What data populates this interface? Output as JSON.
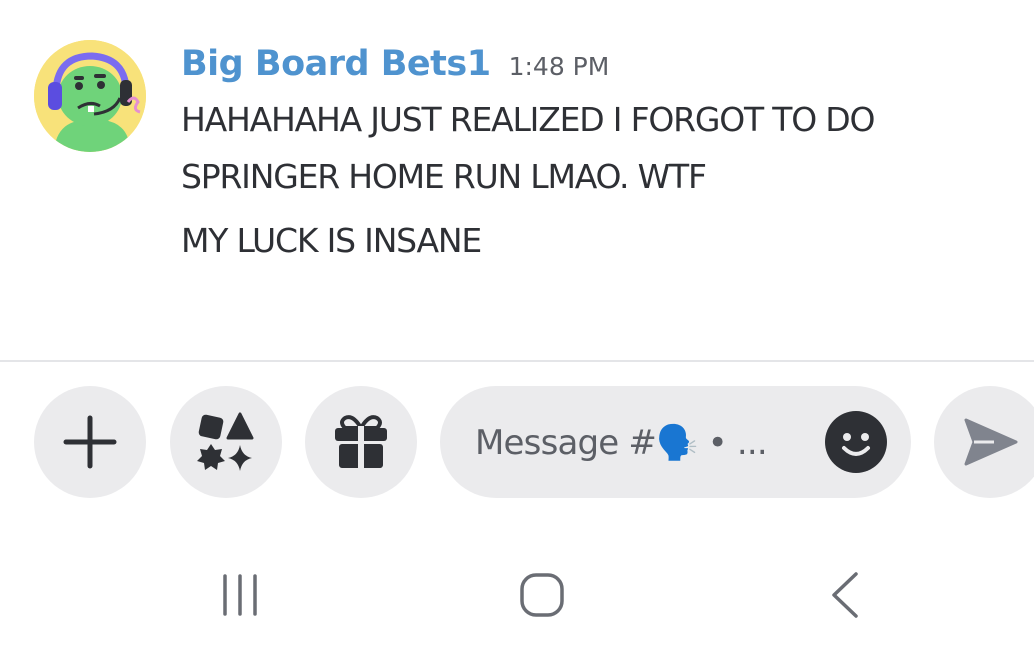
{
  "message": {
    "username": "Big Board Bets1",
    "timestamp": "1:48 PM",
    "lines": [
      "HAHAHAHA JUST REALIZED I FORGOT TO DO",
      "SPRINGER HOME RUN LMAO. WTF",
      "MY LUCK IS INSANE"
    ],
    "avatar_icon": "cartoon-avatar-with-headset"
  },
  "composer": {
    "placeholder": "Message #🗣️ • ...",
    "buttons": {
      "add": "plus-icon",
      "apps": "apps-icon",
      "gift": "gift-icon",
      "emoji": "smiley-icon",
      "send": "send-icon"
    }
  },
  "navbar": {
    "recents": "recents-icon",
    "home": "home-icon",
    "back": "back-icon"
  },
  "colors": {
    "username": "#4f93cf",
    "message_text": "#2e3035",
    "button_bg": "#ebebed",
    "icon_dark": "#2e3035",
    "avatar_bg": "#f8e27a",
    "avatar_face": "#6fd37a"
  }
}
